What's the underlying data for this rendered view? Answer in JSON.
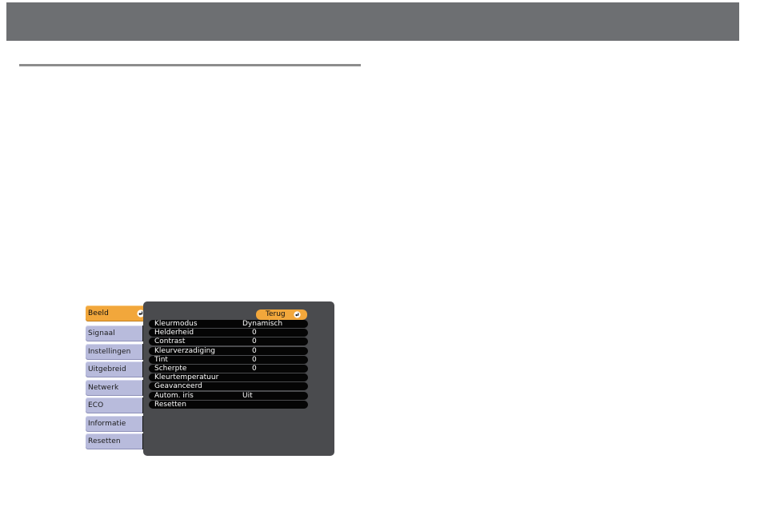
{
  "menu": {
    "items": [
      {
        "label": "Beeld",
        "active": true,
        "icon": "enter-icon"
      },
      {
        "label": "Signaal"
      },
      {
        "label": "Instellingen"
      },
      {
        "label": "Uitgebreid"
      },
      {
        "label": "Netwerk"
      },
      {
        "label": "ECO"
      },
      {
        "label": "Informatie"
      },
      {
        "label": "Resetten"
      }
    ]
  },
  "panel": {
    "back_label": "Terug",
    "rows": [
      {
        "label": "Kleurmodus",
        "value": "Dynamisch"
      },
      {
        "label": "Helderheid",
        "value": "0"
      },
      {
        "label": "Contrast",
        "value": "0"
      },
      {
        "label": "Kleurverzadiging",
        "value": "0"
      },
      {
        "label": "Tint",
        "value": "0"
      },
      {
        "label": "Scherpte",
        "value": "0"
      },
      {
        "label": "Kleurtemperatuur",
        "value": ""
      },
      {
        "label": "Geavanceerd",
        "value": ""
      },
      {
        "label": "Autom. iris",
        "value": "Uit"
      },
      {
        "label": "Resetten",
        "value": ""
      }
    ]
  },
  "colors": {
    "accent": "#f2a73b",
    "menu_item": "#b8bbdc",
    "panel_bg": "#4a4b4e",
    "row_bg": "#050505",
    "header_bar": "#6d6f72"
  }
}
